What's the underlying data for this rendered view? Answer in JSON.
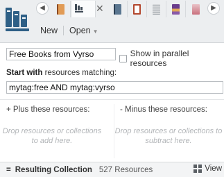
{
  "toolbar": {
    "new_label": "New",
    "open_label": "Open"
  },
  "tabs": [
    {
      "icon": "book-orange-icon"
    },
    {
      "icon": "collection-icon",
      "active": true
    },
    {
      "icon": "book-blue-icon"
    },
    {
      "icon": "book-red-icon"
    },
    {
      "icon": "book-gray-icon"
    },
    {
      "icon": "book-purple-icon"
    },
    {
      "icon": "book-pink-icon"
    }
  ],
  "collection": {
    "title_value": "Free Books from Vyrso",
    "parallel_label": "Show in parallel resources",
    "start_label_bold": "Start with",
    "start_label_rest": " resources matching:",
    "query_value": "mytag:free AND mytag:vyrso"
  },
  "plus": {
    "label": "+ Plus these resources:",
    "drop_text": "Drop resources or collections to add here."
  },
  "minus": {
    "label": "- Minus these resources:",
    "drop_text": "Drop resources or collections to subtract here."
  },
  "result": {
    "symbol": "=",
    "title": "Resulting Collection",
    "count": "527 Resources",
    "view_label": "View"
  },
  "colors": {
    "accent": "#2e5f86",
    "toolbar_bg": "#eceef0"
  }
}
